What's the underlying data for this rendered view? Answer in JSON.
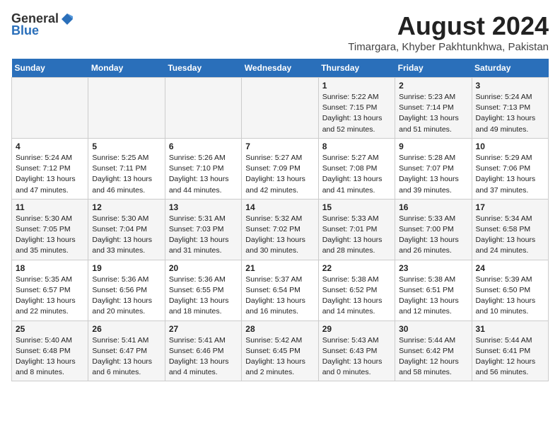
{
  "header": {
    "logo_general": "General",
    "logo_blue": "Blue",
    "main_title": "August 2024",
    "subtitle": "Timargara, Khyber Pakhtunkhwa, Pakistan"
  },
  "days_of_week": [
    "Sunday",
    "Monday",
    "Tuesday",
    "Wednesday",
    "Thursday",
    "Friday",
    "Saturday"
  ],
  "weeks": [
    [
      {
        "day": "",
        "info": ""
      },
      {
        "day": "",
        "info": ""
      },
      {
        "day": "",
        "info": ""
      },
      {
        "day": "",
        "info": ""
      },
      {
        "day": "1",
        "info": "Sunrise: 5:22 AM\nSunset: 7:15 PM\nDaylight: 13 hours\nand 52 minutes."
      },
      {
        "day": "2",
        "info": "Sunrise: 5:23 AM\nSunset: 7:14 PM\nDaylight: 13 hours\nand 51 minutes."
      },
      {
        "day": "3",
        "info": "Sunrise: 5:24 AM\nSunset: 7:13 PM\nDaylight: 13 hours\nand 49 minutes."
      }
    ],
    [
      {
        "day": "4",
        "info": "Sunrise: 5:24 AM\nSunset: 7:12 PM\nDaylight: 13 hours\nand 47 minutes."
      },
      {
        "day": "5",
        "info": "Sunrise: 5:25 AM\nSunset: 7:11 PM\nDaylight: 13 hours\nand 46 minutes."
      },
      {
        "day": "6",
        "info": "Sunrise: 5:26 AM\nSunset: 7:10 PM\nDaylight: 13 hours\nand 44 minutes."
      },
      {
        "day": "7",
        "info": "Sunrise: 5:27 AM\nSunset: 7:09 PM\nDaylight: 13 hours\nand 42 minutes."
      },
      {
        "day": "8",
        "info": "Sunrise: 5:27 AM\nSunset: 7:08 PM\nDaylight: 13 hours\nand 41 minutes."
      },
      {
        "day": "9",
        "info": "Sunrise: 5:28 AM\nSunset: 7:07 PM\nDaylight: 13 hours\nand 39 minutes."
      },
      {
        "day": "10",
        "info": "Sunrise: 5:29 AM\nSunset: 7:06 PM\nDaylight: 13 hours\nand 37 minutes."
      }
    ],
    [
      {
        "day": "11",
        "info": "Sunrise: 5:30 AM\nSunset: 7:05 PM\nDaylight: 13 hours\nand 35 minutes."
      },
      {
        "day": "12",
        "info": "Sunrise: 5:30 AM\nSunset: 7:04 PM\nDaylight: 13 hours\nand 33 minutes."
      },
      {
        "day": "13",
        "info": "Sunrise: 5:31 AM\nSunset: 7:03 PM\nDaylight: 13 hours\nand 31 minutes."
      },
      {
        "day": "14",
        "info": "Sunrise: 5:32 AM\nSunset: 7:02 PM\nDaylight: 13 hours\nand 30 minutes."
      },
      {
        "day": "15",
        "info": "Sunrise: 5:33 AM\nSunset: 7:01 PM\nDaylight: 13 hours\nand 28 minutes."
      },
      {
        "day": "16",
        "info": "Sunrise: 5:33 AM\nSunset: 7:00 PM\nDaylight: 13 hours\nand 26 minutes."
      },
      {
        "day": "17",
        "info": "Sunrise: 5:34 AM\nSunset: 6:58 PM\nDaylight: 13 hours\nand 24 minutes."
      }
    ],
    [
      {
        "day": "18",
        "info": "Sunrise: 5:35 AM\nSunset: 6:57 PM\nDaylight: 13 hours\nand 22 minutes."
      },
      {
        "day": "19",
        "info": "Sunrise: 5:36 AM\nSunset: 6:56 PM\nDaylight: 13 hours\nand 20 minutes."
      },
      {
        "day": "20",
        "info": "Sunrise: 5:36 AM\nSunset: 6:55 PM\nDaylight: 13 hours\nand 18 minutes."
      },
      {
        "day": "21",
        "info": "Sunrise: 5:37 AM\nSunset: 6:54 PM\nDaylight: 13 hours\nand 16 minutes."
      },
      {
        "day": "22",
        "info": "Sunrise: 5:38 AM\nSunset: 6:52 PM\nDaylight: 13 hours\nand 14 minutes."
      },
      {
        "day": "23",
        "info": "Sunrise: 5:38 AM\nSunset: 6:51 PM\nDaylight: 13 hours\nand 12 minutes."
      },
      {
        "day": "24",
        "info": "Sunrise: 5:39 AM\nSunset: 6:50 PM\nDaylight: 13 hours\nand 10 minutes."
      }
    ],
    [
      {
        "day": "25",
        "info": "Sunrise: 5:40 AM\nSunset: 6:48 PM\nDaylight: 13 hours\nand 8 minutes."
      },
      {
        "day": "26",
        "info": "Sunrise: 5:41 AM\nSunset: 6:47 PM\nDaylight: 13 hours\nand 6 minutes."
      },
      {
        "day": "27",
        "info": "Sunrise: 5:41 AM\nSunset: 6:46 PM\nDaylight: 13 hours\nand 4 minutes."
      },
      {
        "day": "28",
        "info": "Sunrise: 5:42 AM\nSunset: 6:45 PM\nDaylight: 13 hours\nand 2 minutes."
      },
      {
        "day": "29",
        "info": "Sunrise: 5:43 AM\nSunset: 6:43 PM\nDaylight: 13 hours\nand 0 minutes."
      },
      {
        "day": "30",
        "info": "Sunrise: 5:44 AM\nSunset: 6:42 PM\nDaylight: 12 hours\nand 58 minutes."
      },
      {
        "day": "31",
        "info": "Sunrise: 5:44 AM\nSunset: 6:41 PM\nDaylight: 12 hours\nand 56 minutes."
      }
    ]
  ]
}
